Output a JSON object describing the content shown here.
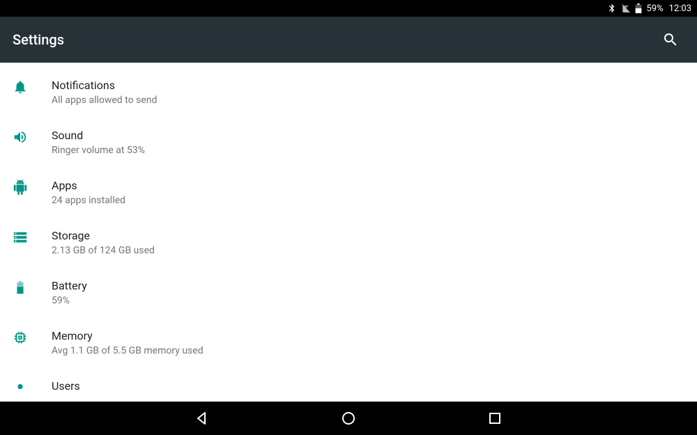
{
  "status": {
    "battery_pct": "59%",
    "time": "12:03"
  },
  "header": {
    "title": "Settings"
  },
  "settings": {
    "items": [
      {
        "title": "Notifications",
        "subtitle": "All apps allowed to send"
      },
      {
        "title": "Sound",
        "subtitle": "Ringer volume at 53%"
      },
      {
        "title": "Apps",
        "subtitle": "24 apps installed"
      },
      {
        "title": "Storage",
        "subtitle": "2.13 GB of 124 GB used"
      },
      {
        "title": "Battery",
        "subtitle": "59%"
      },
      {
        "title": "Memory",
        "subtitle": "Avg 1.1 GB of 5.5 GB memory used"
      },
      {
        "title": "Users",
        "subtitle": ""
      }
    ]
  },
  "colors": {
    "accent": "#009688",
    "appbar": "#263238"
  }
}
